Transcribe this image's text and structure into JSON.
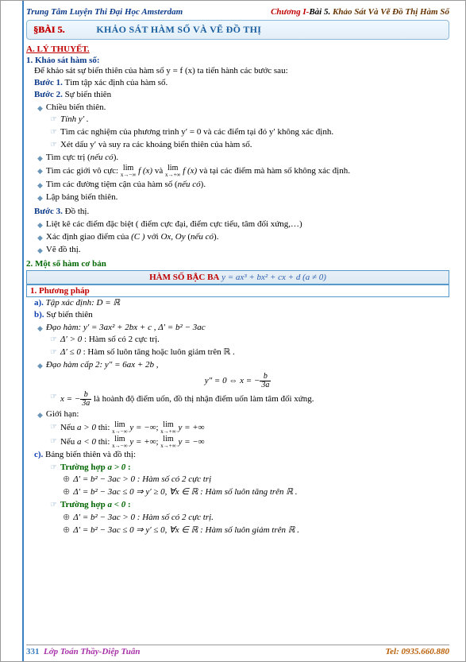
{
  "header": {
    "left": "Trung Tâm Luyện Thi Đại Học Amsterdam",
    "right_red": "Chương I-",
    "right_black": "Bài 5.",
    "right_brown": " Khảo Sát Và Vẽ Đồ Thị Hàm Số"
  },
  "banner": {
    "bai": "§BÀI 5.",
    "title": "KHẢO SÁT HÀM SỐ VÀ VẼ ĐỒ THỊ"
  },
  "sectionA": "A. LÝ THUYẾT.",
  "section1": "1. Khảo sát hàm số:",
  "intro": "Để khảo sát sự biến thiên của hàm số  y = f (x)  ta tiến hành các bước sau:",
  "step1_label": "Bước 1.",
  "step1_text": " Tìm tập xác định của hàm số.",
  "step2_label": "Bước 2.",
  "step2_text": " Sự biến thiên",
  "s2_items": [
    "Chiều biến thiên.",
    "Tính  y′ .",
    "Tìm các nghiệm của phương trình  y′ = 0  và các điểm tại đó  y′ không xác định.",
    "Xét dấu  y′  và suy ra các khoảng biến thiên của hàm số.",
    "Tìm cực trị (nếu có).",
    "Tìm các giới vô cực:  lim f (x)  và  lim f (x)  và tại các điểm mà hàm số không xác định.",
    "Tìm các đường tiệm cận của hàm số (nếu có).",
    "Lập bảng biến thiên."
  ],
  "step3_label": "Bước 3.",
  "step3_text": " Đồ thị.",
  "s3_items": [
    "Liệt kê các điểm đặc biệt ( điểm cực đại, điểm cực tiểu, tâm đối xứng,…)",
    "Xác định giao điểm của (C ) với Ox, Oy (nếu có).",
    "Vẽ đồ thị."
  ],
  "section2": "2. Một số hàm cơ bản",
  "cubic_box_label": "HÀM SỐ BẬC BA",
  "cubic_box_formula": "  y = ax³ + bx² + cx + d    (a ≠ 0)",
  "method_box": "1.  Phương pháp",
  "a_label": "a).",
  "a_text": " Tập xác định:  D = ℝ",
  "b_label": "b).",
  "b_text": " Sự biến thiên",
  "b_items": {
    "dh": "Đạo hàm:  y′ = 3ax² + 2bx + c ,  Δ′ = b² − 3ac",
    "d_pos": "Δ′ > 0 : Hàm số có 2 cực trị.",
    "d_nonpos": "Δ′ ≤ 0 : Hàm số luôn tăng hoặc luôn giảm trên ℝ .",
    "dh2": "Đạo hàm cấp 2:  y″ = 6ax + 2b ,",
    "dh2_center": "y″ = 0 ⇔ x = −",
    "uon": " là hoành độ điểm uốn, đồ thị nhận điểm uốn làm tâm đối xứng.",
    "gh": "Giới hạn:",
    "gh_pos": "Nếu  a > 0  thì:  ",
    "gh_neg": "Nếu  a < 0  thì:  "
  },
  "c_label": "c).",
  "c_text": " Bảng biến thiên và đồ thị:",
  "case_pos": "Trường hợp  a > 0 :",
  "case_pos_items": [
    "Δ′ = b² − 3ac > 0 : Hàm số có 2 cực trị",
    "Δ′ = b² − 3ac ≤ 0 ⇒ y′ ≥ 0, ∀x ∈ ℝ : Hàm số luôn tăng trên ℝ ."
  ],
  "case_neg": "Trường hợp  a < 0 :",
  "case_neg_items": [
    "Δ′ = b² − 3ac > 0 : Hàm số có 2 cực trị.",
    "Δ′ = b² − 3ac ≤ 0 ⇒ y′ ≤ 0, ∀x ∈ ℝ : Hàm số luôn giảm trên ℝ ."
  ],
  "footer": {
    "page": "331",
    "mid": "Lớp Toán Thầy-Diệp Tuân",
    "tel": "Tel: 0935.660.880"
  }
}
